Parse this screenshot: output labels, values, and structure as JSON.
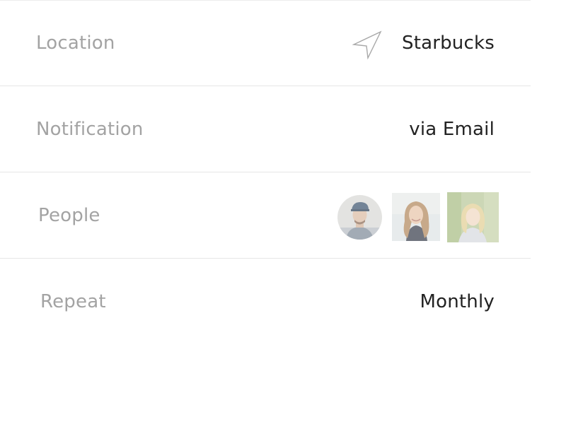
{
  "settings": {
    "location": {
      "label": "Location",
      "value": "Starbucks",
      "icon": "navigation-arrow-icon"
    },
    "notification": {
      "label": "Notification",
      "value": "via Email"
    },
    "people": {
      "label": "People",
      "avatars": [
        {
          "name": "person-1-avatar",
          "shape": "circle"
        },
        {
          "name": "person-2-avatar",
          "shape": "square"
        },
        {
          "name": "person-3-avatar",
          "shape": "square"
        }
      ]
    },
    "repeat": {
      "label": "Repeat",
      "value": "Monthly"
    }
  },
  "colors": {
    "label": "#a3a3a3",
    "value": "#222222",
    "divider": "#e6e6e6",
    "icon_stroke": "#a8a8a8"
  }
}
